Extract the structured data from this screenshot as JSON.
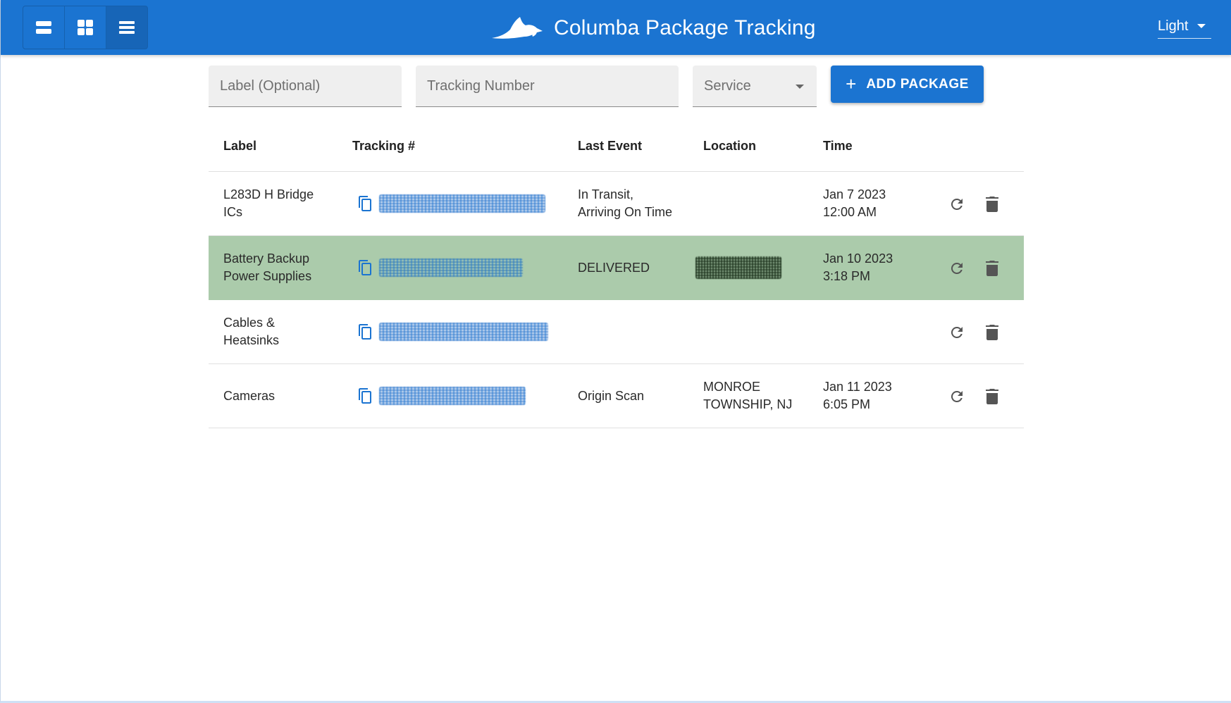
{
  "header": {
    "title": "Columba Package Tracking",
    "logo_icon": "bird-logo-icon",
    "view_toggle": [
      {
        "name": "view-compact-button",
        "icon": "view-agenda-icon",
        "active": false
      },
      {
        "name": "view-grid-button",
        "icon": "view-grid-icon",
        "active": false
      },
      {
        "name": "view-list-button",
        "icon": "view-list-icon",
        "active": true
      }
    ],
    "theme": {
      "value": "Light"
    }
  },
  "form": {
    "label_placeholder": "Label (Optional)",
    "tracking_placeholder": "Tracking Number",
    "service_placeholder": "Service",
    "add_button_label": "ADD PACKAGE"
  },
  "table": {
    "headers": {
      "label": "Label",
      "tracking": "Tracking #",
      "last_event": "Last Event",
      "location": "Location",
      "time": "Time"
    },
    "rows": [
      {
        "label_line1": "L283D H Bridge",
        "label_line2": "ICs",
        "last_event_line1": "In Transit,",
        "last_event_line2": "Arriving On Time",
        "location_line1": "",
        "location_line2": "",
        "time_line1": "Jan 7 2023",
        "time_line2": "12:00 AM",
        "highlighted": false
      },
      {
        "label_line1": "Battery Backup",
        "label_line2": "Power Supplies",
        "last_event_line1": "DELIVERED",
        "last_event_line2": "",
        "location_line1": "",
        "location_line2": "",
        "time_line1": "Jan 10 2023",
        "time_line2": "3:18 PM",
        "highlighted": true
      },
      {
        "label_line1": "Cables &",
        "label_line2": "Heatsinks",
        "last_event_line1": "",
        "last_event_line2": "",
        "location_line1": "",
        "location_line2": "",
        "time_line1": "",
        "time_line2": "",
        "highlighted": false
      },
      {
        "label_line1": "Cameras",
        "label_line2": "",
        "last_event_line1": "Origin Scan",
        "last_event_line2": "",
        "location_line1": "MONROE",
        "location_line2": "TOWNSHIP, NJ",
        "time_line1": "Jan 11 2023",
        "time_line2": "6:05 PM",
        "highlighted": false
      }
    ]
  },
  "colors": {
    "app_bar": "#1b74d1",
    "delivered_row": "#abcbab",
    "accent_icon": "#1b74d1",
    "action_icon": "#555555"
  }
}
